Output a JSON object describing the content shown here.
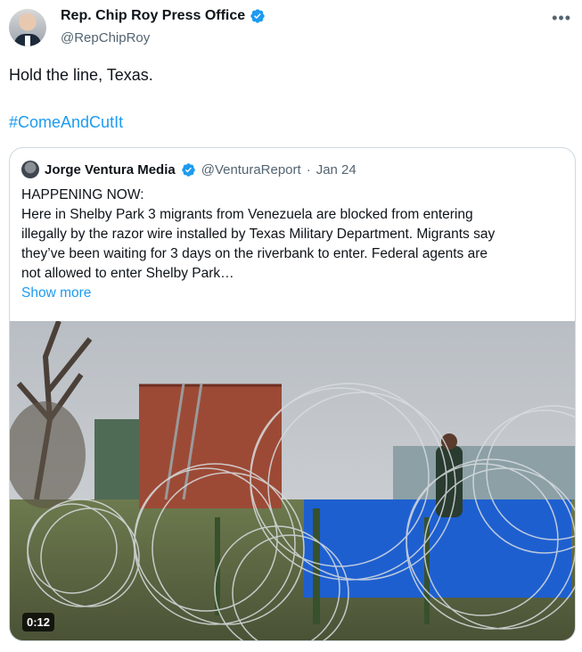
{
  "tweet": {
    "author_name": "Rep. Chip Roy Press Office",
    "author_handle": "@RepChipRoy",
    "text": "Hold the line, Texas.",
    "hashtag": "#ComeAndCutIt",
    "more_icon": "more-horizontal-icon"
  },
  "quote": {
    "author_name": "Jorge Ventura Media",
    "author_handle": "@VenturaReport",
    "separator": "·",
    "date": "Jan 24",
    "lines": [
      "HAPPENING NOW:",
      "Here in Shelby Park 3 migrants from Venezuela are blocked from entering",
      "illegally by the razor wire installed by Texas Military Department. Migrants say",
      "they’ve been waiting for 3 days on the riverbank to enter. Federal agents are",
      "not allowed to enter Shelby Park…"
    ],
    "show_more": "Show more",
    "video_duration": "0:12"
  },
  "colors": {
    "verified": "#1d9bf0",
    "link": "#1d9bf0",
    "secondary_text": "#536471"
  }
}
